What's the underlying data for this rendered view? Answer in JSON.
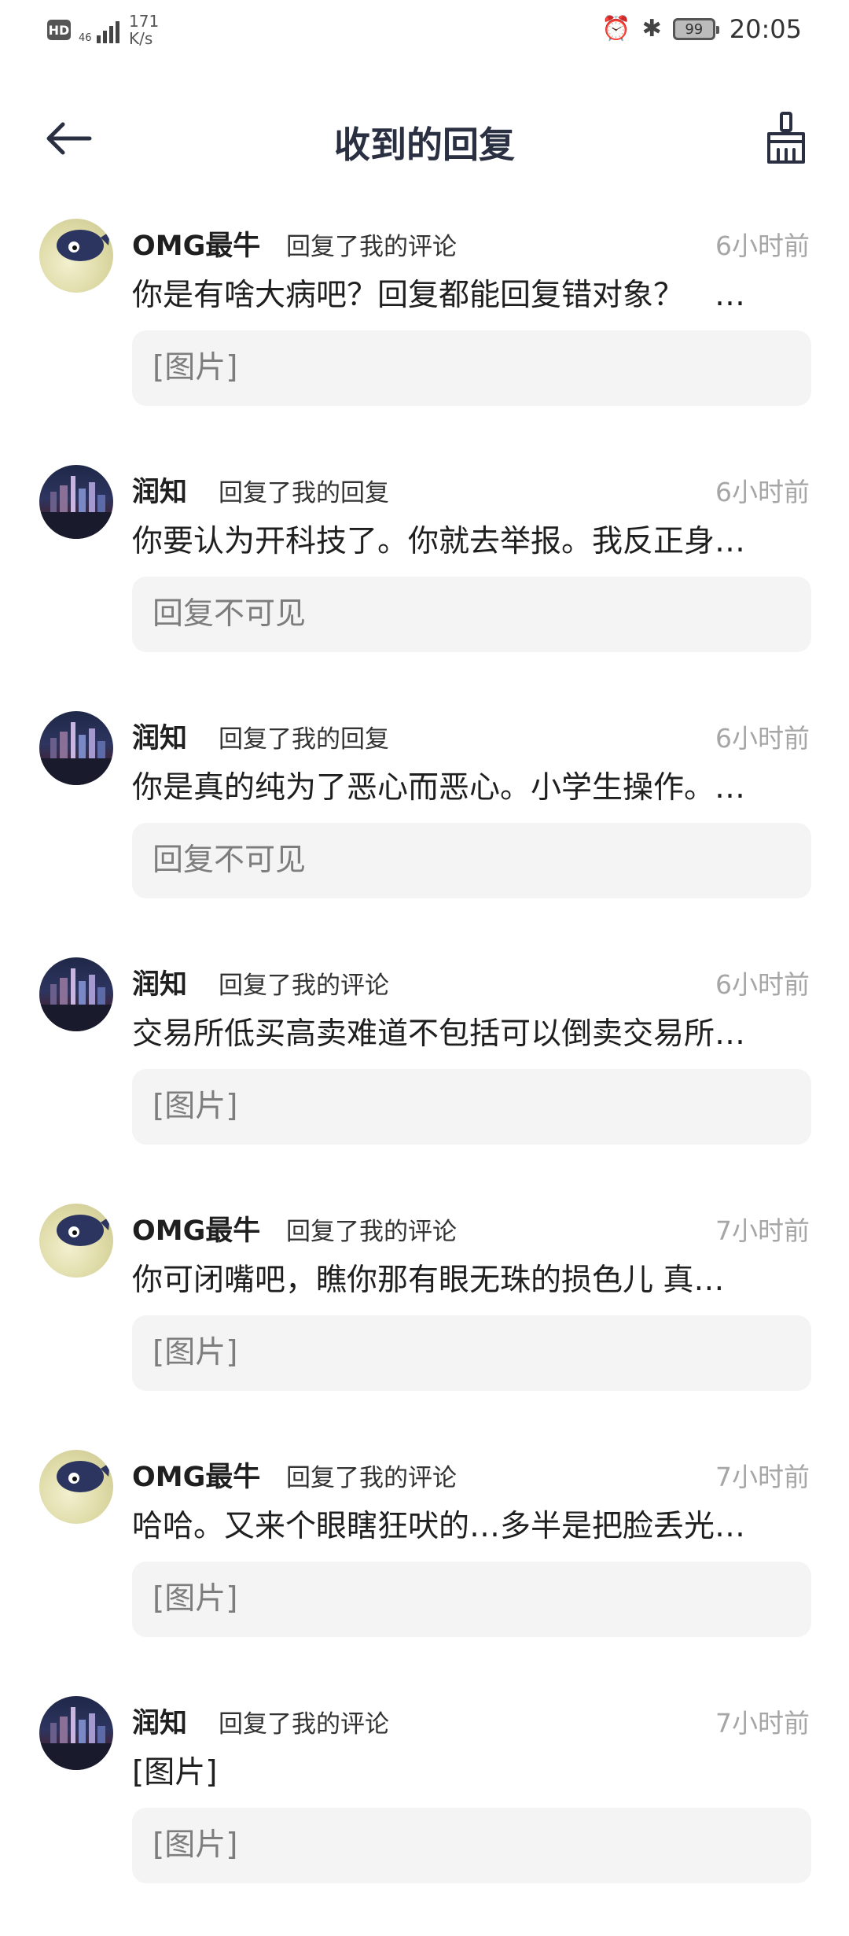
{
  "status_bar": {
    "hd": "HD",
    "network": "46",
    "speed_value": "171",
    "speed_unit": "K/s",
    "battery": "99",
    "time": "20:05"
  },
  "header": {
    "title": "收到的回复",
    "back_icon": "arrow-left-icon",
    "clear_icon": "broom-icon"
  },
  "replies": [
    {
      "name": "OMG最牛",
      "action": "回复了我的评论",
      "time": "6小时前",
      "content": "你是有啥大病吧？回复都能回复错对象？　…",
      "quote": "[图片]",
      "avatar": "pufferfish"
    },
    {
      "name": "润知",
      "action": "回复了我的回复",
      "time": "6小时前",
      "content": "你要认为开科技了。你就去举报。我反正身…",
      "quote": "回复不可见",
      "avatar": "city-night"
    },
    {
      "name": "润知",
      "action": "回复了我的回复",
      "time": "6小时前",
      "content": "你是真的纯为了恶心而恶心。小学生操作。…",
      "quote": "回复不可见",
      "avatar": "city-night"
    },
    {
      "name": "润知",
      "action": "回复了我的评论",
      "time": "6小时前",
      "content": "交易所低买高卖难道不包括可以倒卖交易所…",
      "quote": "[图片]",
      "avatar": "city-night"
    },
    {
      "name": "OMG最牛",
      "action": "回复了我的评论",
      "time": "7小时前",
      "content": "你可闭嘴吧，瞧你那有眼无珠的损色儿 真…",
      "quote": "[图片]",
      "avatar": "pufferfish"
    },
    {
      "name": "OMG最牛",
      "action": "回复了我的评论",
      "time": "7小时前",
      "content": "哈哈。又来个眼瞎狂吠的…多半是把脸丢光…",
      "quote": "[图片]",
      "avatar": "pufferfish"
    },
    {
      "name": "润知",
      "action": "回复了我的评论",
      "time": "7小时前",
      "content": "[图片]",
      "quote": "[图片]",
      "avatar": "city-night"
    }
  ]
}
